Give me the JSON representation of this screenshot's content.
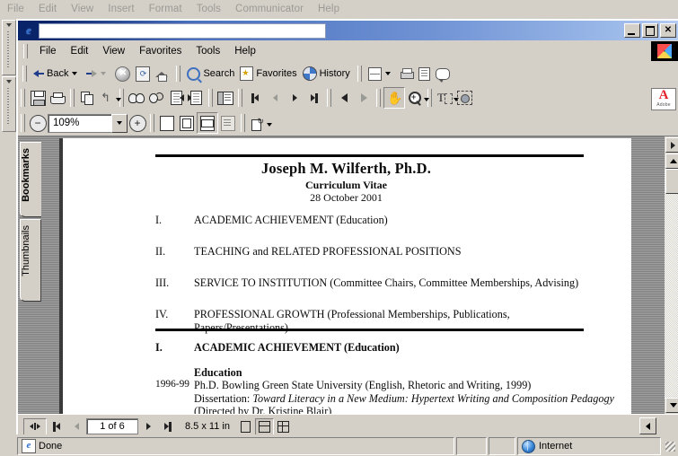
{
  "host_app": {
    "menu": [
      "File",
      "Edit",
      "View",
      "Insert",
      "Format",
      "Tools",
      "Communicator",
      "Help"
    ]
  },
  "browser": {
    "title": "",
    "window_buttons": {
      "minimize": "_",
      "maximize": "□",
      "close": "✕"
    },
    "menu": [
      "File",
      "Edit",
      "View",
      "Favorites",
      "Tools",
      "Help"
    ],
    "toolbar": {
      "back": "Back",
      "forward": "",
      "stop": "stop-icon",
      "refresh": "refresh-icon",
      "home": "home-icon",
      "search": "Search",
      "favorites": "Favorites",
      "history": "History",
      "mail": "mail-icon",
      "print": "print-icon",
      "edit": "edit-icon",
      "discuss": "discuss-icon"
    },
    "status": {
      "message": "Done",
      "zone": "Internet"
    }
  },
  "acrobat": {
    "toolbar_row1": {
      "save": "save-icon",
      "print": "print-icon",
      "copy": "copy-icon",
      "undo": "undo-icon",
      "find": "find-icon",
      "search": "search-pdf-icon",
      "find_previous": "find-previous-icon",
      "find_next": "find-next-icon",
      "show_hide_nav": "navigation-pane-icon",
      "first_page": "first-page-icon",
      "previous_page": "previous-page-icon",
      "next_page": "next-page-icon",
      "last_page": "last-page-icon",
      "go_back": "go-back-view-icon",
      "go_forward": "go-forward-view-icon",
      "hand_tool": "hand-tool-icon",
      "zoom_tool": "zoom-in-tool-icon",
      "text_select_tool": "text-select-tool-icon",
      "graphics_select_tool": "graphics-select-tool-icon",
      "adobe_logo_text": "Adobe",
      "adobe_logo_letter": "A"
    },
    "toolbar_row2": {
      "zoom_out": "−",
      "zoom_value": "109%",
      "zoom_in": "+",
      "actual_size": "actual-size-icon",
      "fit_in_window": "fit-in-window-icon",
      "fit_width": "fit-width-icon",
      "reflow": "reflow-icon",
      "rotate": "rotate-view-icon"
    },
    "nav_tabs": [
      {
        "label": "Bookmarks",
        "active": true
      },
      {
        "label": "Thumbnails",
        "active": false
      }
    ],
    "status": {
      "page_indicator": "1 of 6",
      "page_size": "8.5 x 11 in",
      "view_single": "single-page-view-icon",
      "view_continuous": "continuous-view-icon",
      "view_facing": "continuous-facing-view-icon"
    }
  },
  "document": {
    "title": "Joseph M. Wilferth, Ph.D.",
    "subtitle": "Curriculum Vitae",
    "date": "28 October 2001",
    "toc": [
      {
        "num": "I.",
        "text": "ACADEMIC ACHIEVEMENT (Education)"
      },
      {
        "num": "II.",
        "text": "TEACHING and RELATED PROFESSIONAL POSITIONS"
      },
      {
        "num": "III.",
        "text": "SERVICE TO INSTITUTION (Committee Chairs, Committee Memberships, Advising)"
      },
      {
        "num": "IV.",
        "text": "PROFESSIONAL GROWTH (Professional Memberships, Publications, Papers/Presentations)"
      }
    ],
    "section_one": {
      "num": "I.",
      "heading": "ACADEMIC ACHIEVEMENT (Education)"
    },
    "education": {
      "heading": "Education",
      "years": "1996-99",
      "degree": "Ph.D. Bowling Green State University (English, Rhetoric and Writing, 1999)",
      "dissertation_label": "Dissertation: ",
      "dissertation_title": "Toward Literacy in a New Medium: Hypertext Writing and Composition Pedagogy",
      "dissertation_director": " (Directed by Dr. Kristine Blair)"
    }
  }
}
